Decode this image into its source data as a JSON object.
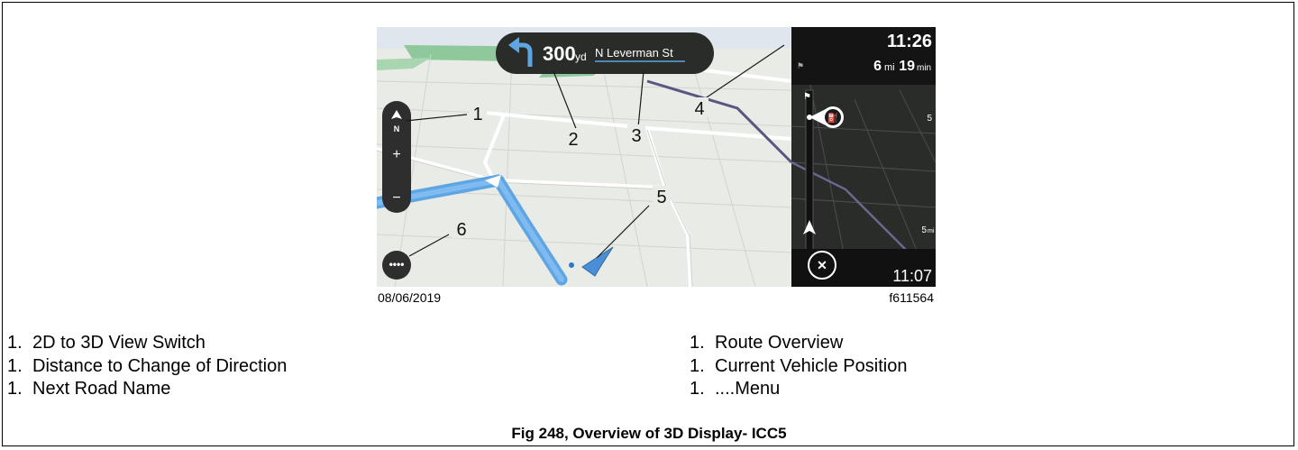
{
  "navigation": {
    "distance_value": "300",
    "distance_unit": "yd",
    "road_name": "N Leverman St",
    "arrival_time": "11:26",
    "remaining_distance_value": "6",
    "remaining_distance_unit": "mi",
    "remaining_time_value": "19",
    "remaining_time_unit": "min",
    "route_bar_distance_mid": "5",
    "route_bar_distance_bottom": "5",
    "route_bar_distance_bottom_unit": "mi",
    "bottom_time": "11:07",
    "compass_label": "N",
    "zoom_in_label": "+",
    "zoom_out_label": "−"
  },
  "callouts": [
    "1",
    "2",
    "3",
    "4",
    "5",
    "6"
  ],
  "image_meta": {
    "date": "08/06/2019",
    "figure_id": "f611564"
  },
  "legend": {
    "left": [
      {
        "num": "1.",
        "label": "2D to 3D View Switch"
      },
      {
        "num": "1.",
        "label": "Distance to Change of Direction"
      },
      {
        "num": "1.",
        "label": "Next Road Name"
      }
    ],
    "right": [
      {
        "num": "1.",
        "label": "Route Overview"
      },
      {
        "num": "1.",
        "label": "Current Vehicle Position"
      },
      {
        "num": "1.",
        "label": "....Menu"
      }
    ]
  },
  "caption": "Fig 248, Overview of 3D Display- ICC5",
  "colors": {
    "map_bg": "#e9ebe6",
    "road_white": "#ffffff",
    "route_blue": "#6aa8e0",
    "park_green": "#7fc08a",
    "panel_dark": "#1f1f1f",
    "vehicle_blue": "#2b78c8"
  }
}
